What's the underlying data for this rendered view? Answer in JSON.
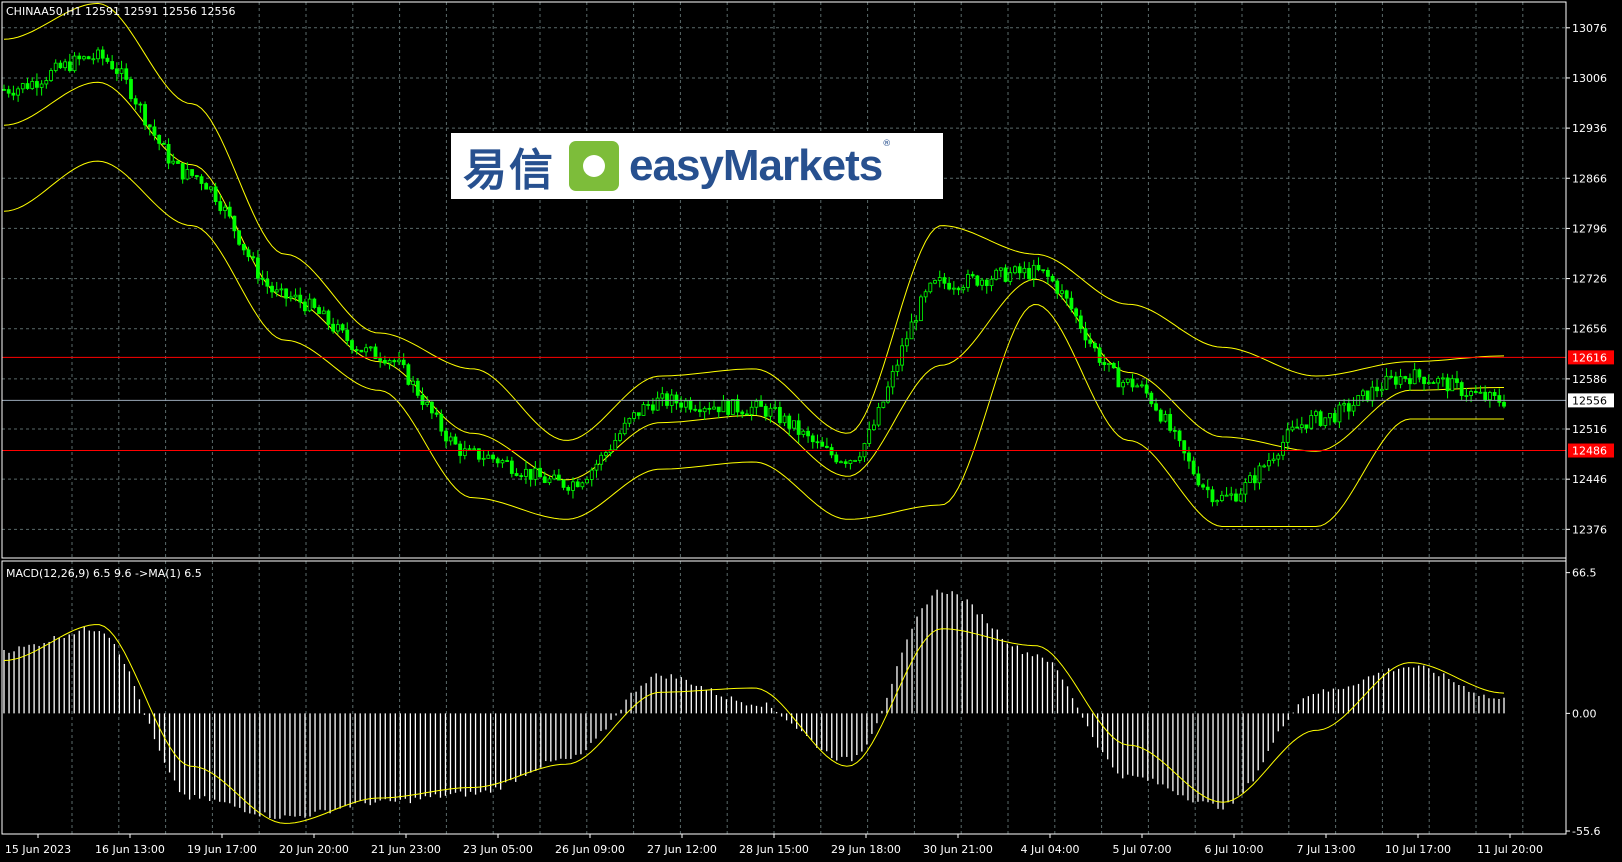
{
  "header": {
    "symbol_line": "CHINAA50,H1  12591 12591 12556 12556",
    "macd_line": "MACD(12,26,9) 6.5 9.6  ->MA(1) 6.5"
  },
  "logo": {
    "cn": "易信",
    "en": "easyMarkets",
    "reg": "®"
  },
  "colors": {
    "background": "#000000",
    "grid": "#5a6a6a",
    "candle": "#00ff00",
    "bollinger": "#ffff00",
    "level_line": "#ff0000",
    "price_line": "#9aa8b8",
    "macd_hist": "#ffffff",
    "macd_signal": "#ffff00"
  },
  "price_axis": {
    "ticks": [
      "13076",
      "13006",
      "12936",
      "12866",
      "12796",
      "12726",
      "12656",
      "12586",
      "12516",
      "12446",
      "12376"
    ],
    "tick_values": [
      13076,
      13006,
      12936,
      12866,
      12796,
      12726,
      12656,
      12586,
      12516,
      12446,
      12376
    ],
    "range": [
      12336,
      13112
    ]
  },
  "macd_axis": {
    "ticks": [
      "66.5",
      "0.00",
      "-55.6"
    ],
    "tick_values": [
      66.5,
      0,
      -55.6
    ],
    "range": [
      -57,
      72
    ]
  },
  "time_axis": {
    "labels": [
      "15 Jun 2023",
      "16 Jun 13:00",
      "19 Jun 17:00",
      "20 Jun 20:00",
      "21 Jun 23:00",
      "23 Jun 05:00",
      "26 Jun 09:00",
      "27 Jun 12:00",
      "28 Jun 15:00",
      "29 Jun 18:00",
      "30 Jun 21:00",
      "4 Jul 04:00",
      "5 Jul 07:00",
      "6 Jul 10:00",
      "7 Jul 13:00",
      "10 Jul 17:00",
      "11 Jul 20:00"
    ]
  },
  "levels": [
    {
      "label": "12616",
      "value": 12616
    },
    {
      "label": "12486",
      "value": 12486
    }
  ],
  "current_price": {
    "label": "12556",
    "value": 12556
  },
  "chart_data": [
    {
      "type": "line",
      "title": "CHINAA50,H1",
      "description": "Hourly candlestick price series with Bollinger Bands, approximate close values at anchor points",
      "x": [
        "15 Jun 2023",
        "16 Jun 13:00",
        "19 Jun 17:00",
        "20 Jun 20:00",
        "21 Jun 23:00",
        "23 Jun 05:00",
        "26 Jun 09:00",
        "27 Jun 12:00",
        "28 Jun 15:00",
        "29 Jun 18:00",
        "30 Jun 21:00",
        "4 Jul 04:00",
        "5 Jul 07:00",
        "6 Jul 10:00",
        "7 Jul 13:00",
        "10 Jul 17:00",
        "11 Jul 20:00"
      ],
      "series": [
        {
          "name": "Close",
          "values": [
            12990,
            13035,
            12870,
            12700,
            12620,
            12480,
            12440,
            12555,
            12545,
            12475,
            12720,
            12735,
            12580,
            12420,
            12530,
            12590,
            12556
          ]
        },
        {
          "name": "Upper Band",
          "values": [
            13060,
            13110,
            12970,
            12760,
            12650,
            12600,
            12500,
            12590,
            12600,
            12510,
            12800,
            12760,
            12690,
            12630,
            12590,
            12610,
            12618
          ]
        },
        {
          "name": "Lower Band",
          "values": [
            12820,
            12890,
            12800,
            12640,
            12570,
            12420,
            12390,
            12460,
            12470,
            12390,
            12410,
            12690,
            12500,
            12380,
            12380,
            12530,
            12530
          ]
        }
      ],
      "ylim": [
        12336,
        13112
      ]
    },
    {
      "type": "bar",
      "title": "MACD(12,26,9) 6.5 9.6  ->MA(1) 6.5",
      "description": "MACD histogram with signal line, approximate values at anchor points",
      "x": [
        "15 Jun 2023",
        "16 Jun 13:00",
        "19 Jun 17:00",
        "20 Jun 20:00",
        "21 Jun 23:00",
        "23 Jun 05:00",
        "26 Jun 09:00",
        "27 Jun 12:00",
        "28 Jun 15:00",
        "29 Jun 18:00",
        "30 Jun 21:00",
        "4 Jul 04:00",
        "5 Jul 07:00",
        "6 Jul 10:00",
        "7 Jul 13:00",
        "10 Jul 17:00",
        "11 Jul 20:00"
      ],
      "series": [
        {
          "name": "MACD",
          "values": [
            30,
            40,
            -40,
            -49,
            -42,
            -38,
            -22,
            18,
            5,
            -22,
            58,
            28,
            -30,
            -44,
            10,
            22,
            6.5
          ]
        },
        {
          "name": "Signal",
          "values": [
            25,
            42,
            -25,
            -52,
            -40,
            -35,
            -24,
            10,
            12,
            -25,
            40,
            32,
            -15,
            -42,
            -8,
            24,
            9.6
          ]
        }
      ],
      "ylim": [
        -57,
        72
      ]
    }
  ]
}
